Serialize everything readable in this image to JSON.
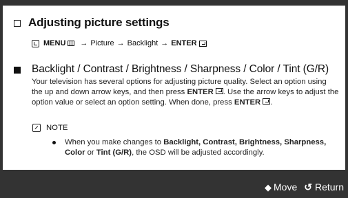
{
  "title": "Adjusting picture settings",
  "menu_path": {
    "menu_label": "MENU",
    "picture_label": "Picture",
    "backlight_label": "Backlight",
    "enter_label": "ENTER",
    "arrow": "→"
  },
  "section": {
    "title": "Backlight / Contrast / Brightness / Sharpness / Color / Tint (G/R)",
    "body_part1": "Your television has several options for adjusting picture quality. Select an option using the up and down arrow keys, and then press ",
    "body_enter1": "ENTER",
    "body_part2": ". Use the arrow keys to adjust the option value or select an option setting. When done, press ",
    "body_enter2": "ENTER",
    "body_part3": "."
  },
  "note": {
    "label": "NOTE",
    "item_prefix": "When you make changes to ",
    "item_bold1": "Backlight, Contrast, Brightness, Sharpness, Color",
    "item_or": " or ",
    "item_bold2": "Tint (G/R)",
    "item_suffix": ", the OSD will be adjusted accordingly."
  },
  "footer": {
    "move_label": "Move",
    "move_icon": "up-down-icon",
    "return_label": "Return",
    "return_icon": "return-icon"
  }
}
